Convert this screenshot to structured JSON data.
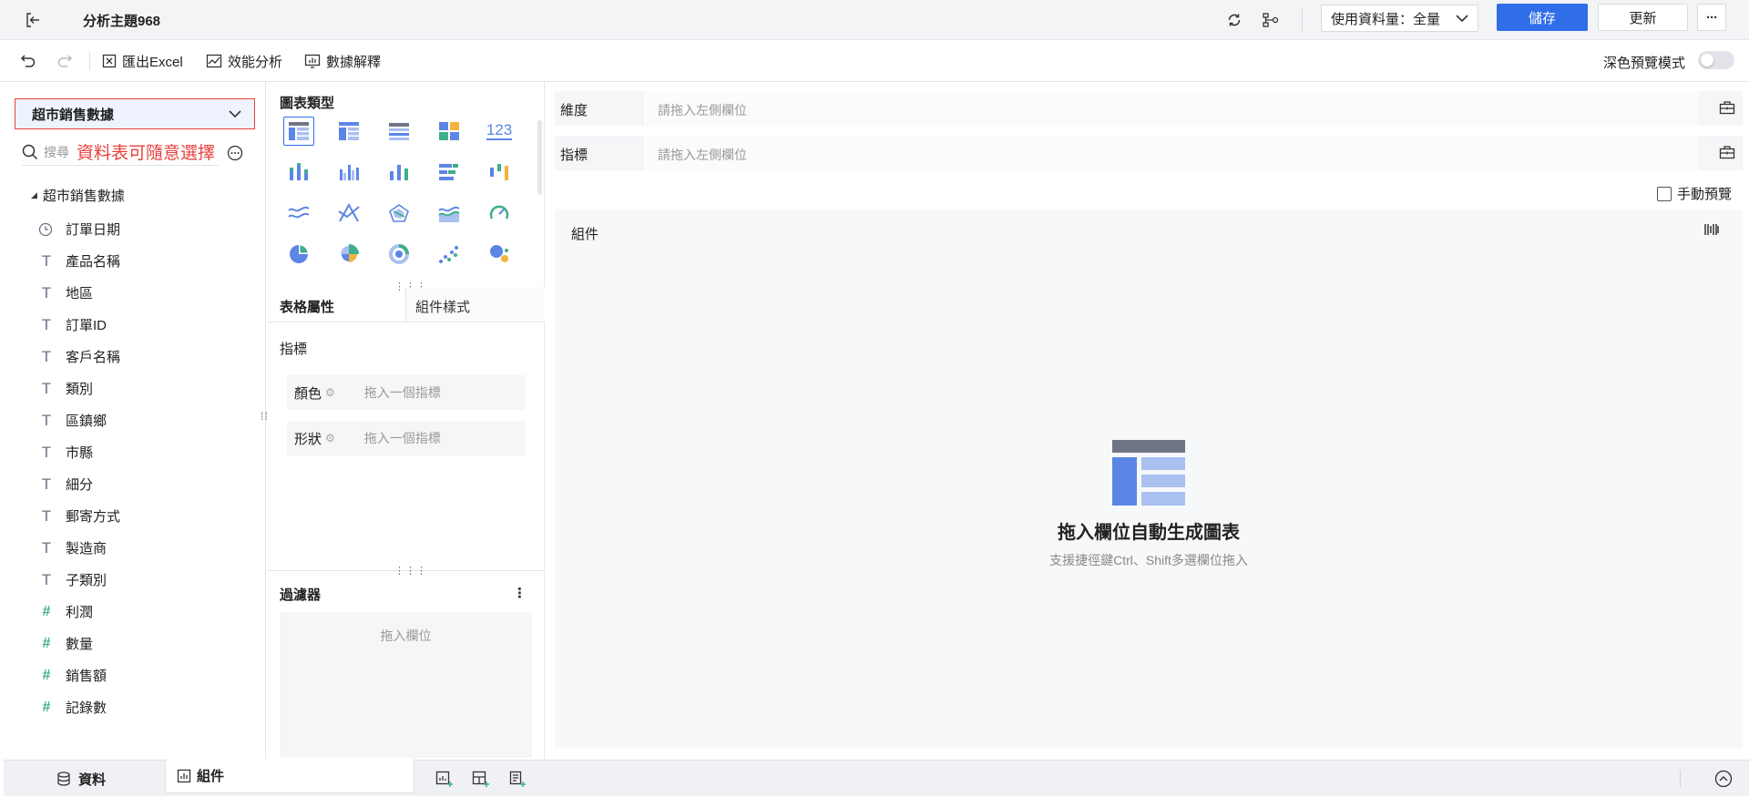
{
  "topbar": {
    "title": "分析主題968",
    "data_volume_label": "使用資料量：全量",
    "save_label": "儲存",
    "refresh_label": "更新",
    "more_label": "···"
  },
  "toolbar": {
    "export_excel": "匯出Excel",
    "performance_analysis": "效能分析",
    "data_explain": "數據解釋",
    "dark_preview": "深色預覽模式"
  },
  "dataset": {
    "selected": "超市銷售數據",
    "search_placeholder": "搜尋",
    "annotation": "資料表可隨意選擇",
    "tree_root": "超市銷售數據",
    "fields": [
      {
        "name": "訂單日期",
        "type": "date"
      },
      {
        "name": "產品名稱",
        "type": "text"
      },
      {
        "name": "地區",
        "type": "text"
      },
      {
        "name": "訂單ID",
        "type": "text"
      },
      {
        "name": "客戶名稱",
        "type": "text"
      },
      {
        "name": "類別",
        "type": "text"
      },
      {
        "name": "區鎮鄉",
        "type": "text"
      },
      {
        "name": "市縣",
        "type": "text"
      },
      {
        "name": "細分",
        "type": "text"
      },
      {
        "name": "郵寄方式",
        "type": "text"
      },
      {
        "name": "製造商",
        "type": "text"
      },
      {
        "name": "子類別",
        "type": "text"
      },
      {
        "name": "利潤",
        "type": "number"
      },
      {
        "name": "數量",
        "type": "number"
      },
      {
        "name": "銷售額",
        "type": "number"
      },
      {
        "name": "記錄數",
        "type": "number"
      }
    ]
  },
  "chart_types": {
    "title": "圖表類型",
    "kpi_label": "123"
  },
  "props": {
    "tab_table": "表格屬性",
    "tab_style": "組件樣式",
    "metrics_title": "指標",
    "color_label": "顏色",
    "shape_label": "形狀",
    "drop_metric_placeholder": "拖入一個指標"
  },
  "filter": {
    "title": "過濾器",
    "placeholder": "拖入欄位"
  },
  "canvas": {
    "dimension_label": "維度",
    "metric_label": "指標",
    "drop_placeholder": "請拖入左側欄位",
    "manual_preview": "手動預覽",
    "component_label": "組件",
    "empty_title": "拖入欄位自動生成圖表",
    "empty_hint": "支援捷徑鍵Ctrl、Shift多選欄位拖入"
  },
  "bottom": {
    "tab_data": "資料",
    "tab_component": "組件"
  },
  "colors": {
    "accent": "#2f6ee8",
    "annotation": "#e8413c",
    "chart_blue": "#5b86e5",
    "chart_light": "#a9c0f0",
    "chart_dark": "#6e7686"
  }
}
